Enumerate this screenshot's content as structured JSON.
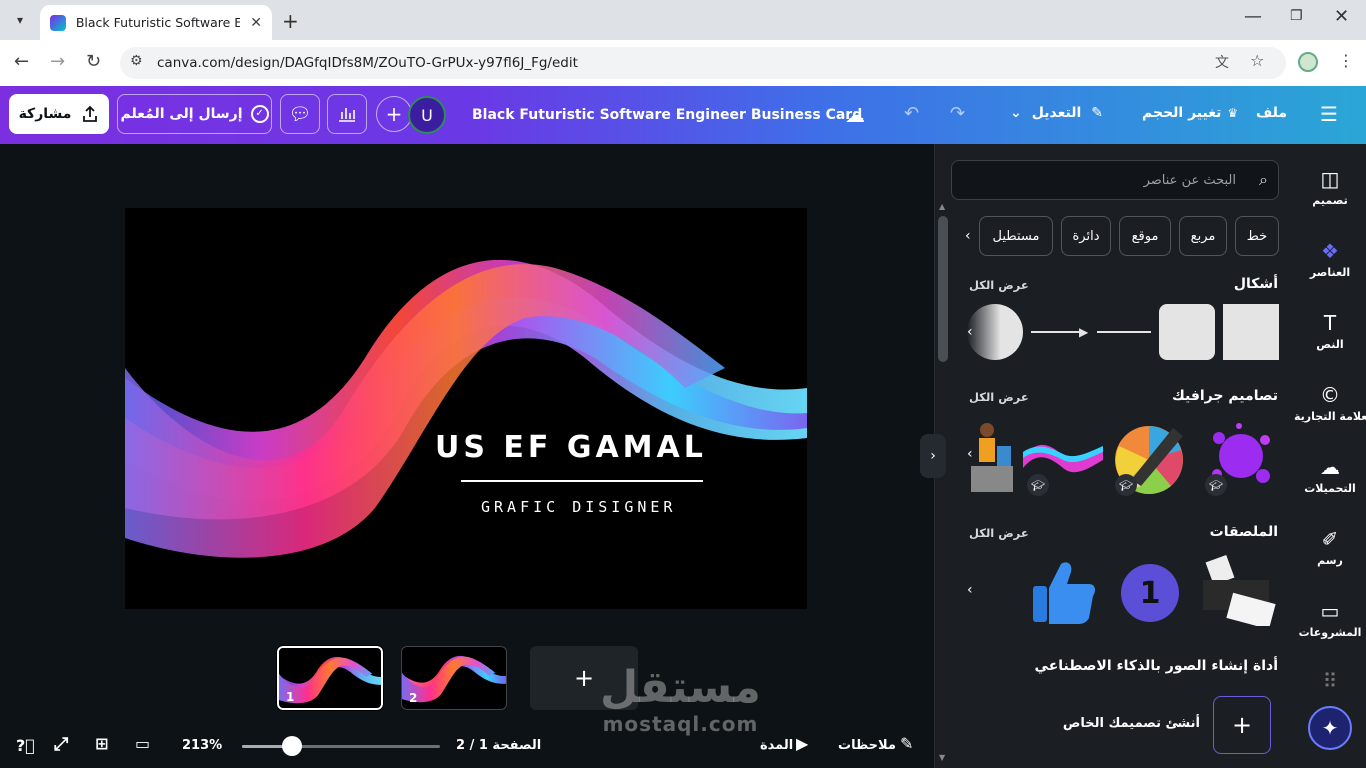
{
  "browser": {
    "tab_title": "Black Futuristic Software Engine",
    "url": "canva.com/design/DAGfqIDfs8M/ZOuTO-GrPUx-y97fl6J_Fg/edit"
  },
  "header": {
    "share_label": "مشاركة",
    "send_teacher_label": "إرسال إلى المُعلم",
    "avatar_initial": "U",
    "design_title": "Black Futuristic Software Engineer Business Card",
    "edit_label": "التعديل",
    "resize_label": "تغيير الحجم",
    "file_label": "ملف"
  },
  "canvas": {
    "card_name": "US EF GAMAL",
    "card_role": "GRAFIC DISIGNER",
    "thumbnails": [
      {
        "num": "1",
        "selected": true
      },
      {
        "num": "2",
        "selected": false
      }
    ]
  },
  "bottom_bar": {
    "zoom_label": "213%",
    "zoom_value": 0.25,
    "page_label": "الصفحة 1 / 2",
    "duration_label": "المدة",
    "notes_label": "ملاحظات"
  },
  "panel": {
    "search_placeholder": "البحث عن عناصر",
    "chips": [
      "خط",
      "مربع",
      "موقع",
      "دائرة",
      "مستطيل"
    ],
    "sections": {
      "shapes": "أشكال",
      "graphics": "تصاميم جرافيك",
      "stickers": "الملصقات",
      "see_all": "عرض الكل"
    },
    "sticker_number": "1",
    "ai_title": "أداة إنشاء الصور بالذكاء الاصطناعي",
    "ai_create_label": "أنشئ تصميمك الخاص"
  },
  "rail": {
    "items": [
      {
        "label": "تصميم",
        "icon": "layout-icon"
      },
      {
        "label": "العناصر",
        "icon": "elements-icon"
      },
      {
        "label": "النص",
        "icon": "text-icon"
      },
      {
        "label": "العلامة التجارية",
        "icon": "brand-icon"
      },
      {
        "label": "التحميلات",
        "icon": "upload-icon"
      },
      {
        "label": "رسم",
        "icon": "draw-icon"
      },
      {
        "label": "المشروعات",
        "icon": "folder-icon"
      }
    ]
  },
  "watermark": {
    "arabic": "مستقل",
    "latin": "mostaql.com"
  },
  "colors": {
    "header_start": "#7b2fe0",
    "header_end": "#2aa6d6",
    "workspace": "#0d1216",
    "panel": "#1b1f24"
  }
}
